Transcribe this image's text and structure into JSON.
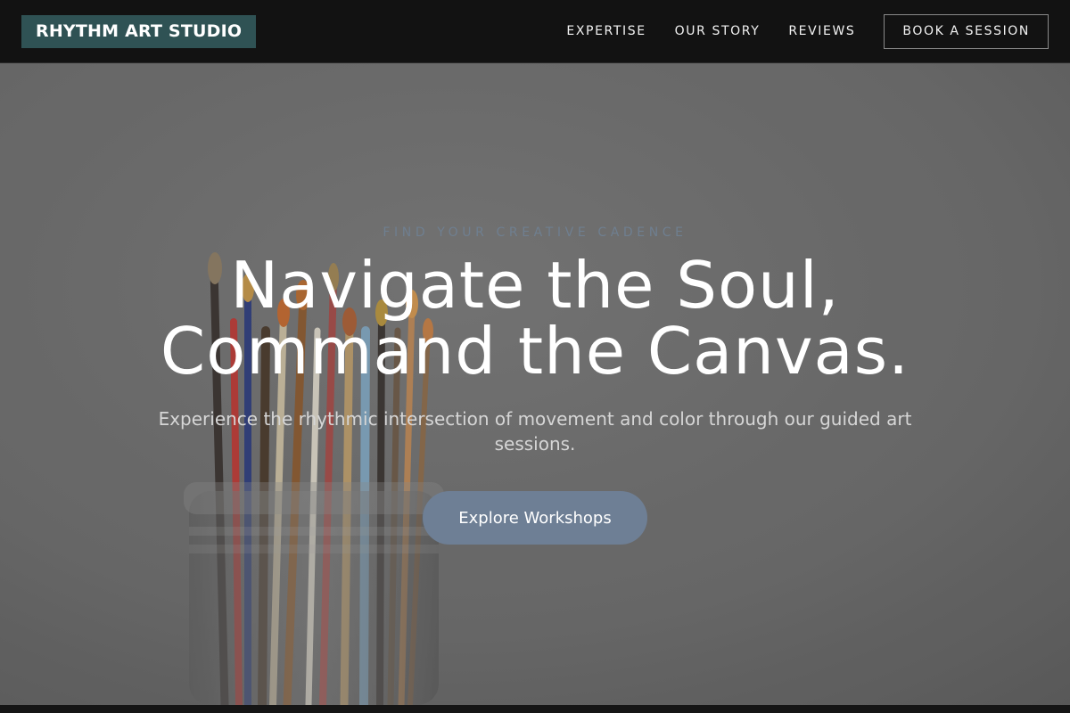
{
  "header": {
    "logo": "RHYTHM ART STUDIO",
    "nav": [
      {
        "label": "EXPERTISE"
      },
      {
        "label": "OUR STORY"
      },
      {
        "label": "REVIEWS"
      }
    ],
    "cta_label": "BOOK A SESSION"
  },
  "hero": {
    "eyebrow": "FIND YOUR CREATIVE CADENCE",
    "headline_line1": "Navigate the Soul,",
    "headline_line2": "Command the Canvas.",
    "subtext": "Experience the rhythmic intersection of movement and color through our guided art sessions.",
    "cta_label": "Explore Workshops",
    "background_image": "paint-brushes-in-jar"
  },
  "colors": {
    "header_bg": "#121212",
    "logo_bg": "#2f5254",
    "hero_bg": "#6c6c6c",
    "accent": "#6e7f95",
    "eyebrow": "#6f7f90"
  }
}
